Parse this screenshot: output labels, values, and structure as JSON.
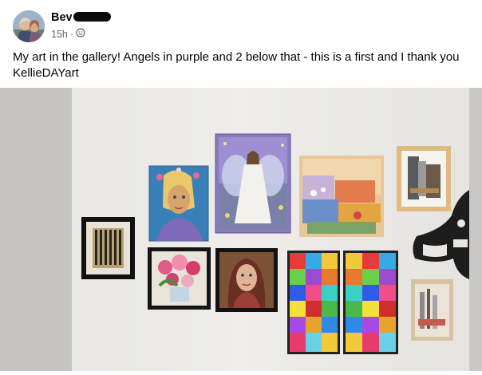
{
  "post": {
    "author": "Bev",
    "timestamp": "15h",
    "audience_icon": "globe-icon",
    "caption": "My art in the gallery! Angels in purple and 2 below that - this is a first and I thank you KellieDAYart"
  },
  "colors": {
    "text_primary": "#050505",
    "text_secondary": "#65676b",
    "wall": "#e9e8e4",
    "side_bar": "#c4c3c1"
  }
}
